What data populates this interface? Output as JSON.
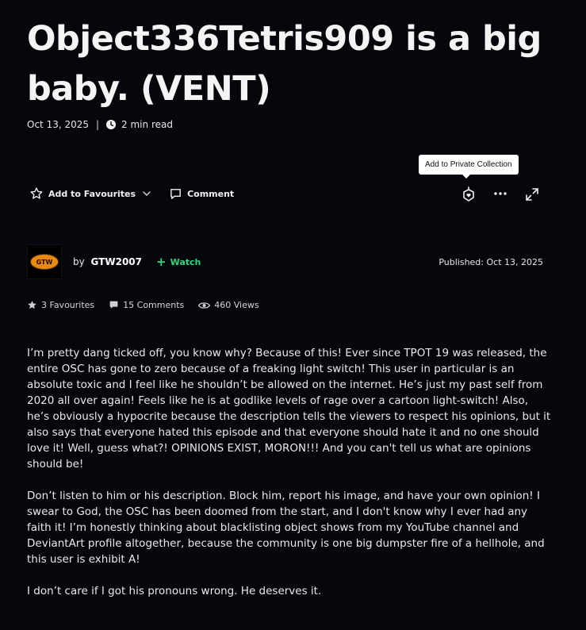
{
  "article": {
    "title": "Object336Tetris909 is a big baby. (VENT)",
    "date": "Oct 13, 2025",
    "separator": "|",
    "read_time": "2 min read"
  },
  "tooltip": {
    "text": "Add to Private Collection"
  },
  "actions": {
    "favourite_label": "Add to Favourites",
    "comment_label": "Comment"
  },
  "author": {
    "by_prefix": "by",
    "name": "GTW2007",
    "avatar_text": "GTW",
    "watch_label": "Watch",
    "published": "Published: Oct 13, 2025"
  },
  "stats": {
    "favourites": "3 Favourites",
    "comments": "15 Comments",
    "views": "460 Views"
  },
  "body": {
    "paragraphs": [
      "I’m pretty dang ticked off, you know why? Because of this! Ever since TPOT 19 was released, the entire OSC has gone to zero because of a freaking  light switch! This user in particular is an absolute toxic and I feel like he shouldn’t be allowed on the internet. He’s just my past self from 2020 all over again! Feels like he is at godlike levels of rage over a cartoon light-switch! Also, he’s obviously a hypocrite because the description tells the viewers to respect his opinions, but it also says that everyone hated this episode and that everyone should hate it and no one should love it! Well, guess what?! OPINIONS EXIST, MORON!!! And you can't tell us what are opinions should be!",
      "Don’t listen to him or his description. Block him, report his image, and have your own opinion! I swear to God, the OSC has been doomed from the start, and I don't know why I ever had any faith it! I’m honestly thinking about blacklisting object shows from my YouTube channel and DeviantArt profile altogether, because the community is one big dumpster fire of a hellhole, and this user is exhibit A!",
      "I don’t care if I got his pronouns wrong. He deserves it."
    ]
  },
  "icons": {
    "clock": "clock-icon",
    "star": "star-icon",
    "chevron": "chevron-down-icon",
    "comment": "comment-icon",
    "collection": "private-collection-icon",
    "more": "more-dots-icon",
    "expand": "expand-icon",
    "views": "eye-icon"
  },
  "colors": {
    "background": "#06070d",
    "watch_accent": "#2fd67e",
    "avatar_orange": "#e88a12"
  }
}
